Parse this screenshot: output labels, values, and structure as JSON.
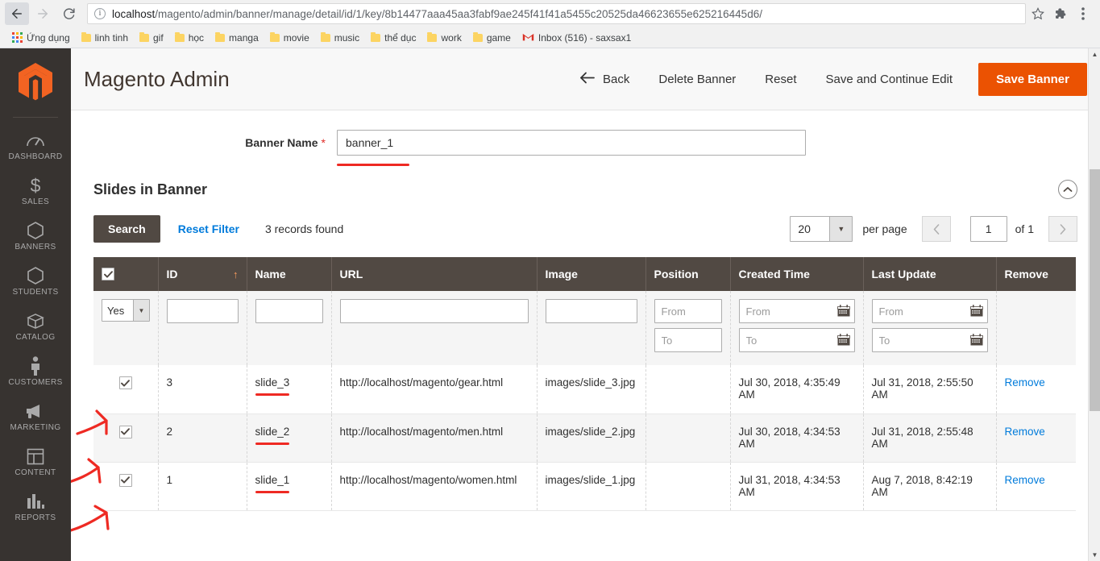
{
  "browser": {
    "url_host": "localhost",
    "url_rest": "/magento/admin/banner/manage/detail/id/1/key/8b14477aaa45aa3fabf9ae245f41f41a5455c20525da46623655e625216445d6/",
    "bookmarks": [
      {
        "label": "Ứng dụng",
        "icon": "apps-grid-icon"
      },
      {
        "label": "linh tinh",
        "icon": "folder-icon"
      },
      {
        "label": "gif",
        "icon": "folder-icon"
      },
      {
        "label": "học",
        "icon": "folder-icon"
      },
      {
        "label": "manga",
        "icon": "folder-icon"
      },
      {
        "label": "movie",
        "icon": "folder-icon"
      },
      {
        "label": "music",
        "icon": "folder-icon"
      },
      {
        "label": "thể dục",
        "icon": "folder-icon"
      },
      {
        "label": "work",
        "icon": "folder-icon"
      },
      {
        "label": "game",
        "icon": "folder-icon"
      },
      {
        "label": "Inbox (516) - saxsax1",
        "icon": "gmail-icon"
      }
    ]
  },
  "sidebar": {
    "items": [
      {
        "label": "DASHBOARD",
        "icon": "dashboard-icon"
      },
      {
        "label": "SALES",
        "icon": "dollar-icon"
      },
      {
        "label": "BANNERS",
        "icon": "hexagon-icon"
      },
      {
        "label": "STUDENTS",
        "icon": "hexagon-icon"
      },
      {
        "label": "CATALOG",
        "icon": "box-icon"
      },
      {
        "label": "CUSTOMERS",
        "icon": "person-icon"
      },
      {
        "label": "MARKETING",
        "icon": "megaphone-icon"
      },
      {
        "label": "CONTENT",
        "icon": "layout-icon"
      },
      {
        "label": "REPORTS",
        "icon": "bar-chart-icon"
      }
    ]
  },
  "header": {
    "title": "Magento Admin",
    "back_label": "Back",
    "delete_label": "Delete Banner",
    "reset_label": "Reset",
    "save_continue_label": "Save and Continue Edit",
    "save_label": "Save Banner",
    "primary_color": "#eb5202"
  },
  "form": {
    "banner_name_label": "Banner Name",
    "required_marker": "*",
    "banner_name_value": "banner_1"
  },
  "section": {
    "title": "Slides in Banner",
    "collapse_icon": "chevron-up-circle-icon"
  },
  "toolbar": {
    "search_label": "Search",
    "reset_filter_label": "Reset Filter",
    "records_found": "3 records found",
    "per_page_value": "20",
    "per_page_label": "per page",
    "page_value": "1",
    "of_pages": "of 1"
  },
  "grid": {
    "columns": [
      {
        "key": "checkbox",
        "label": ""
      },
      {
        "key": "id",
        "label": "ID"
      },
      {
        "key": "name",
        "label": "Name"
      },
      {
        "key": "url",
        "label": "URL"
      },
      {
        "key": "image",
        "label": "Image"
      },
      {
        "key": "position",
        "label": "Position"
      },
      {
        "key": "created",
        "label": "Created Time"
      },
      {
        "key": "updated",
        "label": "Last Update"
      },
      {
        "key": "remove",
        "label": "Remove"
      }
    ],
    "sort_column": "ID",
    "sort_direction": "asc",
    "filters": {
      "select_value": "Yes",
      "id_value": "",
      "name_value": "",
      "url_value": "",
      "image_value": "",
      "position_from": "From",
      "position_to": "To",
      "created_from": "From",
      "created_to": "To",
      "updated_from": "From",
      "updated_to": "To"
    },
    "rows": [
      {
        "checked": true,
        "id": "3",
        "name": "slide_3",
        "url": "http://localhost/magento/gear.html",
        "image": "images/slide_3.jpg",
        "position": "",
        "created": "Jul 30, 2018, 4:35:49 AM",
        "updated": "Jul 31, 2018, 2:55:50 AM",
        "remove": "Remove"
      },
      {
        "checked": true,
        "id": "2",
        "name": "slide_2",
        "url": "http://localhost/magento/men.html",
        "image": "images/slide_2.jpg",
        "position": "",
        "created": "Jul 30, 2018, 4:34:53 AM",
        "updated": "Jul 31, 2018, 2:55:48 AM",
        "remove": "Remove"
      },
      {
        "checked": true,
        "id": "1",
        "name": "slide_1",
        "url": "http://localhost/magento/women.html",
        "image": "images/slide_1.jpg",
        "position": "",
        "created": "Jul 31, 2018, 4:34:53 AM",
        "updated": "Aug 7, 2018, 8:42:19 AM",
        "remove": "Remove"
      }
    ]
  },
  "annotations": {
    "color": "#ee2a23"
  }
}
